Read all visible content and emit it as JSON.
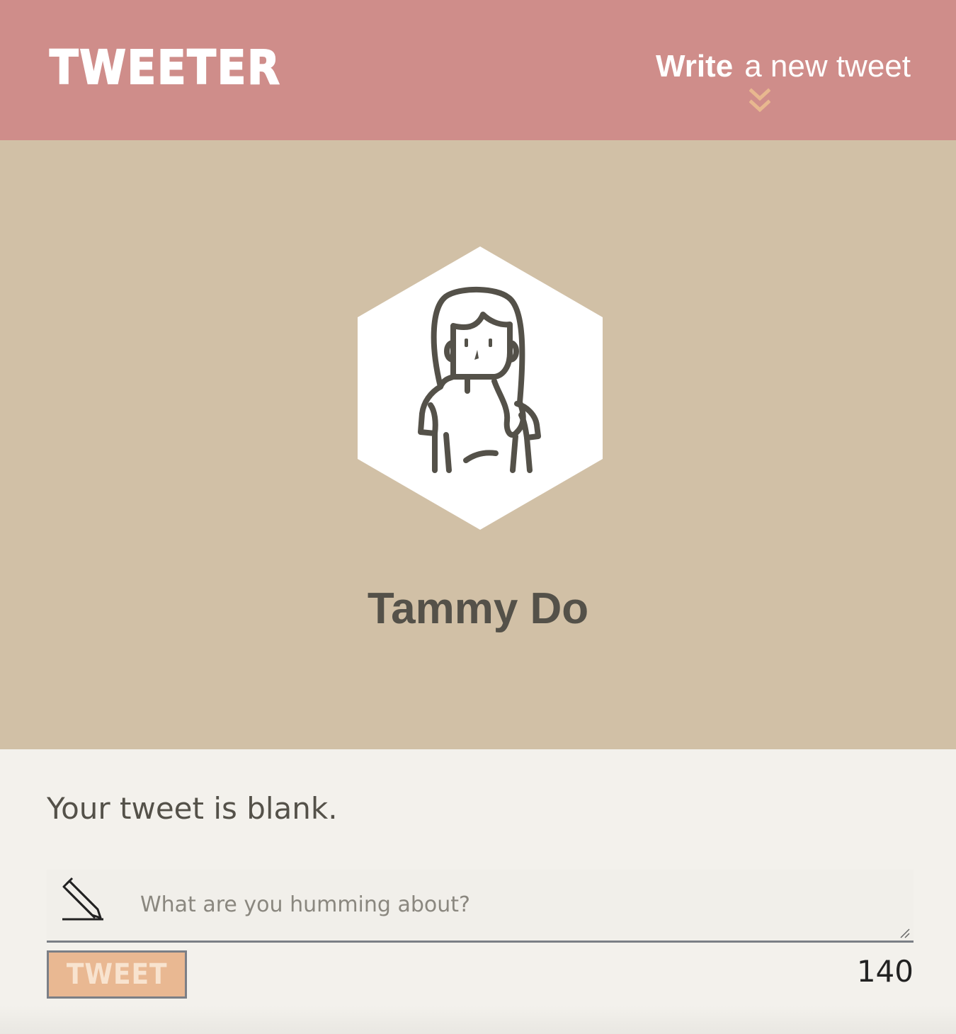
{
  "header": {
    "logo": "TWEETER",
    "compose_bold": "Write",
    "compose_rest": "a new tweet",
    "toggle_icon": "double-chevron-down-icon"
  },
  "profile": {
    "name": "Tammy Do",
    "avatar_icon": "person-avatar-icon"
  },
  "composer": {
    "error": "Your tweet is blank.",
    "placeholder": "What are you humming about?",
    "value": "",
    "input_icon": "pencil-icon",
    "submit_label": "TWEET",
    "counter": "140"
  },
  "colors": {
    "nav": "#cf8d8a",
    "profile_bg": "#d1c0a6",
    "text": "#545149",
    "button": "#e9b892",
    "chevron": "#e8b88f"
  }
}
